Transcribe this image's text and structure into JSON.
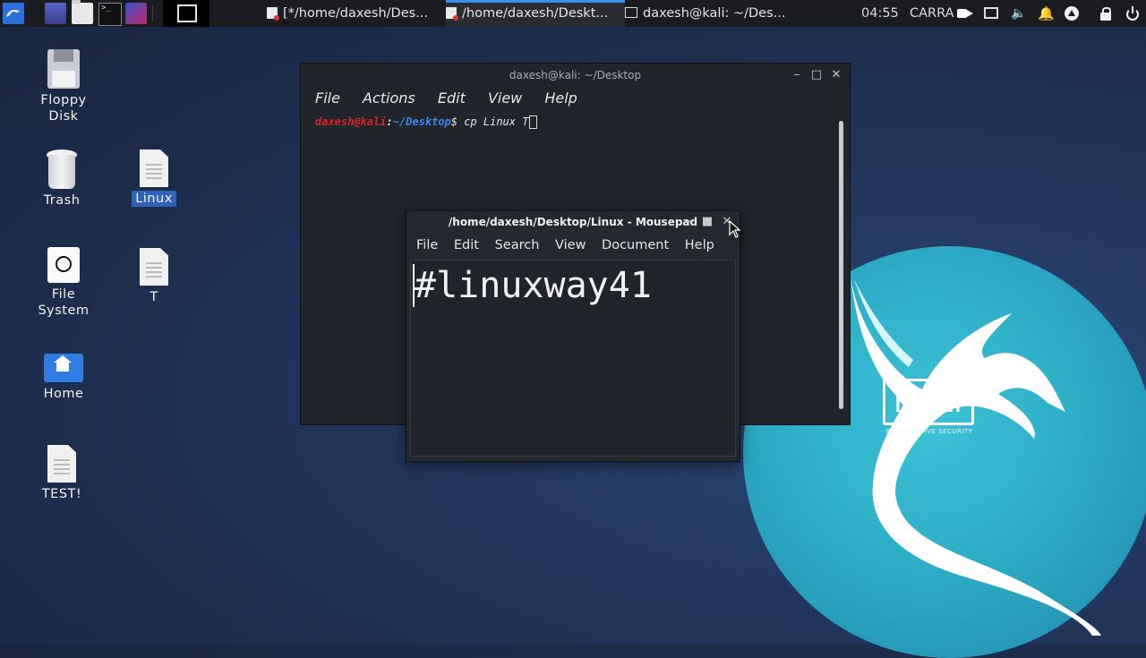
{
  "panel": {
    "tasks": [
      {
        "label": "[*/home/daxesh/Des..."
      },
      {
        "label": "/home/daxesh/Deskt..."
      },
      {
        "label": "daxesh@kali: ~/Des..."
      }
    ],
    "clock": "04:55",
    "user": "CARRA",
    "icons": [
      "kali-menu-icon",
      "app-icon",
      "file-manager-icon",
      "terminal-icon",
      "screen-recorder-icon",
      "show-desktop-icon",
      "camera-icon",
      "display-icon",
      "volume-icon",
      "bell-icon",
      "update-icon",
      "lock-icon",
      "power-icon"
    ]
  },
  "desktop": {
    "icons": [
      {
        "label": "Floppy Disk"
      },
      {
        "label": "Trash"
      },
      {
        "label": "Linux"
      },
      {
        "label": "File System"
      },
      {
        "label": "T"
      },
      {
        "label": "Home"
      },
      {
        "label": "TEST!"
      }
    ]
  },
  "wallpaper": {
    "logo_text": "KALI",
    "logo_sub": "BY OFFENSIVE SECURITY"
  },
  "terminal": {
    "title": "daxesh@kali: ~/Desktop",
    "menu": [
      "File",
      "Actions",
      "Edit",
      "View",
      "Help"
    ],
    "prompt_user": "daxesh@kali",
    "prompt_path": "~/Desktop",
    "command": "$ cp Linux T"
  },
  "mousepad": {
    "title": "/home/daxesh/Desktop/Linux - Mousepad",
    "menu": [
      "File",
      "Edit",
      "Search",
      "View",
      "Document",
      "Help"
    ],
    "content": "#linuxway41"
  },
  "colors": {
    "prompt_user": "#d8262c",
    "prompt_path": "#3f84f0",
    "accent": "#3b8ef0"
  }
}
